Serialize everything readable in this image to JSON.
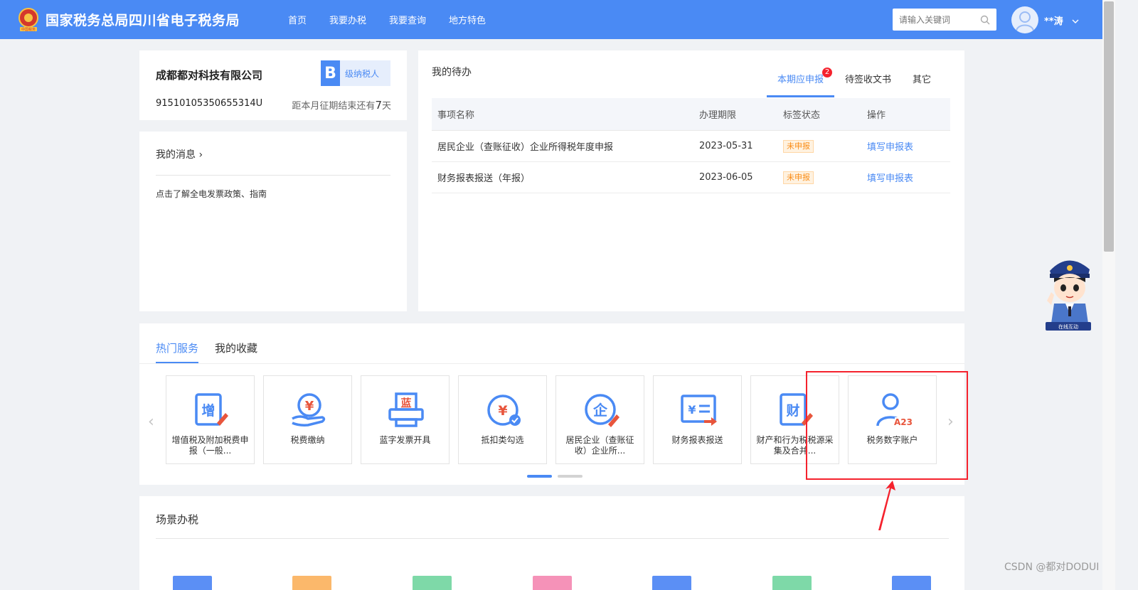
{
  "header": {
    "site_title": "国家税务总局四川省电子税务局",
    "nav": [
      "首页",
      "我要办税",
      "我要查询",
      "地方特色"
    ],
    "search_placeholder": "请输入关键词",
    "user_name": "**涛"
  },
  "company": {
    "name": "成都都对科技有限公司",
    "level_letter": "B",
    "level_text": "级纳税人",
    "tax_id": "91510105350655314U",
    "deadline_prefix": "距本月征期结束还有",
    "deadline_days": "7",
    "deadline_suffix": "天"
  },
  "messages": {
    "title": "我的消息 ›",
    "items": [
      "点击了解全电发票政策、指南"
    ]
  },
  "todo": {
    "title": "我的待办",
    "tabs": [
      {
        "label": "本期应申报",
        "badge": "2"
      },
      {
        "label": "待签收文书"
      },
      {
        "label": "其它"
      }
    ],
    "columns": [
      "事项名称",
      "办理期限",
      "标签状态",
      "操作"
    ],
    "rows": [
      {
        "name": "居民企业（查账征收）企业所得税年度申报",
        "deadline": "2023-05-31",
        "status": "未申报",
        "action": "填写申报表"
      },
      {
        "name": "财务报表报送（年报）",
        "deadline": "2023-06-05",
        "status": "未申报",
        "action": "填写申报表"
      }
    ]
  },
  "services": {
    "tabs": [
      "热门服务",
      "我的收藏"
    ],
    "tiles": [
      {
        "label": "增值税及附加税费申报（一般...",
        "icon": "vat-declare-icon",
        "glyph": "增"
      },
      {
        "label": "税费缴纳",
        "icon": "tax-payment-icon",
        "glyph": "¥"
      },
      {
        "label": "蓝字发票开具",
        "icon": "invoice-issue-icon",
        "glyph": "蓝"
      },
      {
        "label": "抵扣类勾选",
        "icon": "deduction-select-icon",
        "glyph": "¥"
      },
      {
        "label": "居民企业（查账征收）企业所...",
        "icon": "enterprise-tax-icon",
        "glyph": "企"
      },
      {
        "label": "财务报表报送",
        "icon": "financial-report-icon",
        "glyph": "¥"
      },
      {
        "label": "财产和行为税税源采集及合并...",
        "icon": "property-tax-icon",
        "glyph": "财"
      },
      {
        "label": "税务数字账户",
        "icon": "digital-account-icon",
        "glyph": "A23"
      }
    ]
  },
  "scene": {
    "title": "场景办税"
  },
  "watermark": "CSDN @都对DODUI",
  "colors": {
    "primary": "#4a8af4",
    "warning": "#fa8c16",
    "annotation": "#f5222d",
    "tile_accent": "#e8553c"
  }
}
